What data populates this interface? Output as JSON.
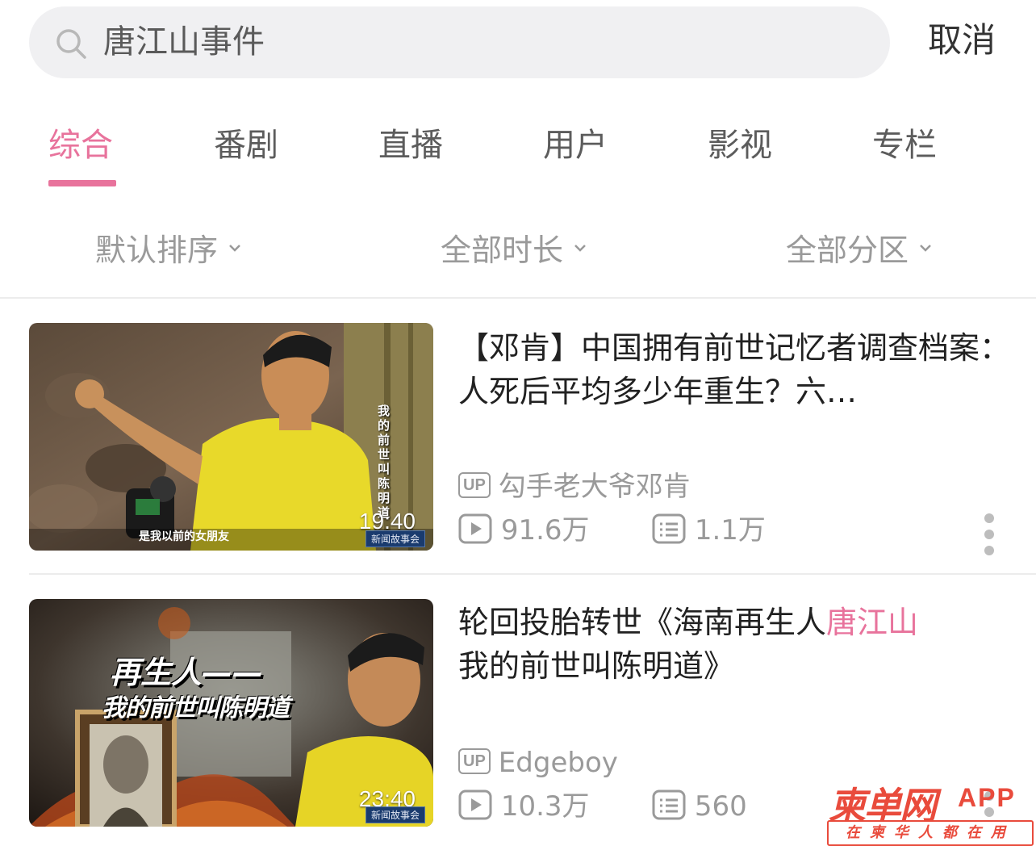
{
  "search": {
    "query": "唐江山事件",
    "cancel_label": "取消"
  },
  "tabs": [
    {
      "label": "综合",
      "active": true
    },
    {
      "label": "番剧"
    },
    {
      "label": "直播"
    },
    {
      "label": "用户"
    },
    {
      "label": "影视"
    },
    {
      "label": "专栏"
    }
  ],
  "filters": [
    "默认排序",
    "全部时长",
    "全部分区"
  ],
  "colors": {
    "accent": "#e8739c",
    "muted": "#9a9a9a",
    "watermark": "#e94b3c"
  },
  "results": [
    {
      "title": "【邓肯】中国拥有前世记忆者调查档案：人死后平均多少年重生？六…",
      "up_badge": "UP",
      "uploader": "勾手老大爷邓肯",
      "plays": "91.6万",
      "comments": "1.1万",
      "duration": "19:40",
      "thumb_caption": "是我以前的女朋友",
      "thumb_side_text": "我的前世叫陈明道",
      "thumb_badge": "新闻故事会"
    },
    {
      "title_before": "轮回投胎转世《海南再生人",
      "title_highlight": "唐江山",
      "title_after": "我的前世叫陈明道》",
      "up_badge": "UP",
      "uploader": "Edgeboy",
      "plays": "10.3万",
      "comments": "560",
      "duration": "23:40",
      "thumb_overlay_line1": "再生人——",
      "thumb_overlay_line2": "我的前世叫陈明道",
      "thumb_badge": "新闻故事会"
    }
  ],
  "watermark": {
    "logo": "柬单网",
    "app": "APP",
    "slogan": "在柬华人都在用"
  }
}
